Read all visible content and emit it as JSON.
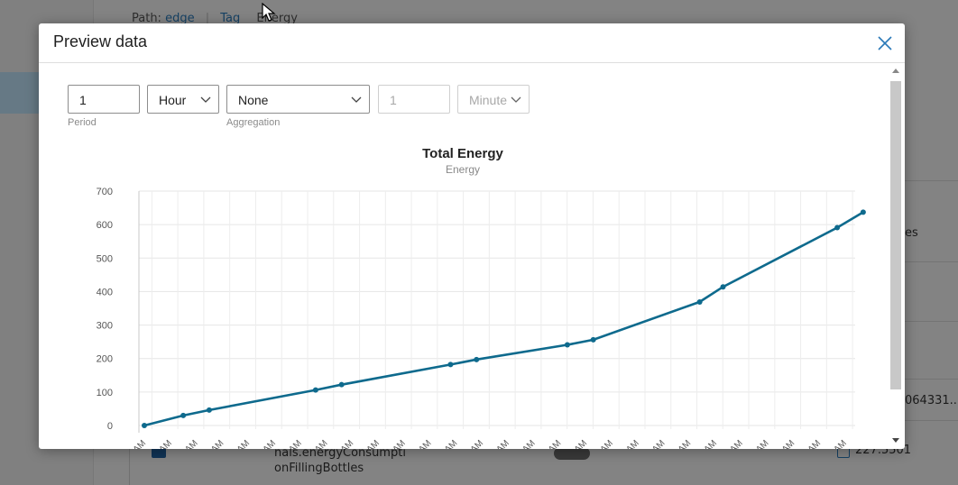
{
  "background": {
    "path_label": "Path:",
    "path_link": "edge",
    "path_tab": "Tag",
    "path_item": "Energy",
    "cell_right_1": "es",
    "cell_right_2": "064331...",
    "row_name_line1": "nals.energyConsumpti",
    "row_name_line2": "onFillingBottles",
    "row_value": "227.5501"
  },
  "modal": {
    "title": "Preview data"
  },
  "controls": {
    "period_value": "1",
    "period_label": "Period",
    "unit_value": "Hour",
    "aggregation_value": "None",
    "aggregation_label": "Aggregation",
    "interval_value": "1",
    "interval_unit": "Minute"
  },
  "chart_data": {
    "type": "line",
    "title": "Total Energy",
    "subtitle": "Energy",
    "ylim": [
      0,
      700
    ],
    "yticks": [
      0,
      100,
      200,
      300,
      400,
      500,
      600,
      700
    ],
    "x_tick_label": "AM",
    "x_tick_count": 28,
    "grid": true,
    "color": "#0e6a8d",
    "values": [
      0,
      30,
      46,
      106,
      122,
      182,
      197,
      241,
      256,
      369,
      414,
      591,
      637
    ],
    "point_slots": [
      0,
      1.5,
      2.5,
      6.6,
      7.6,
      11.8,
      12.8,
      16.3,
      17.3,
      21.4,
      22.3,
      26.7,
      27.7
    ]
  }
}
